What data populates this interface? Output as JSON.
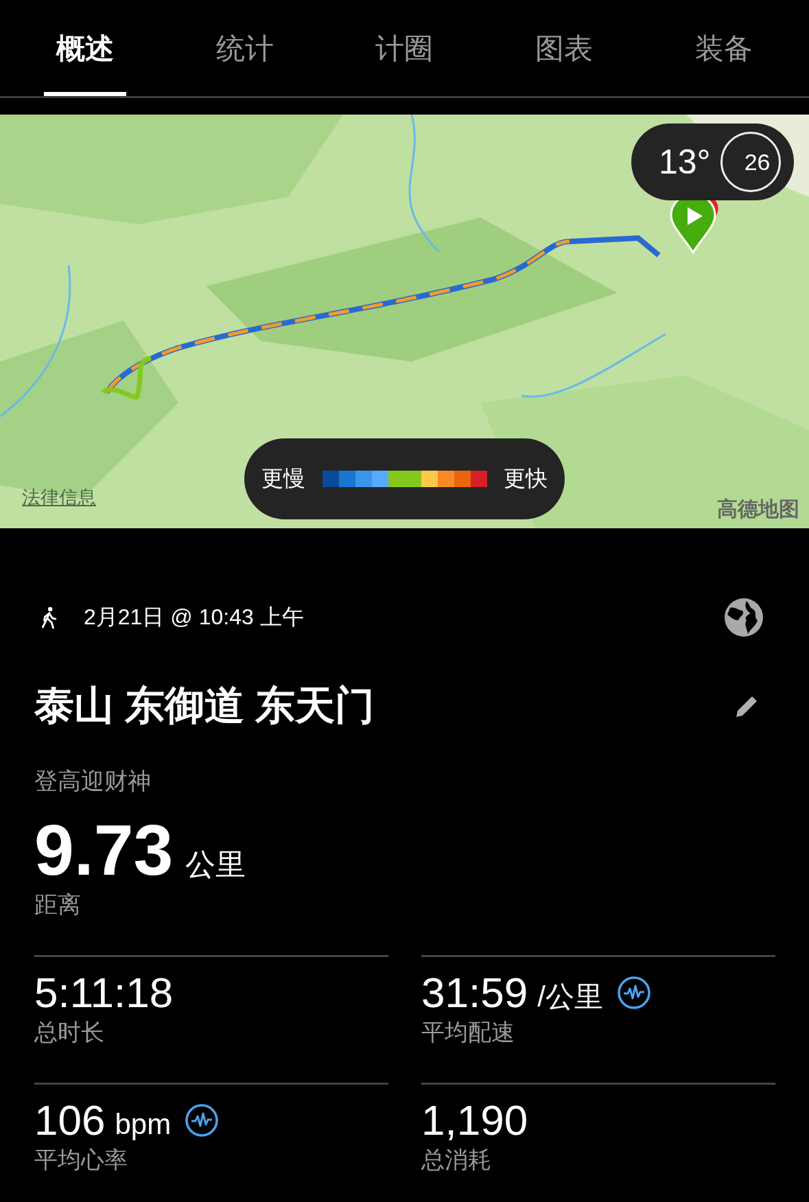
{
  "tabs": [
    {
      "label": "概述",
      "selected": true
    },
    {
      "label": "统计",
      "selected": false
    },
    {
      "label": "计圈",
      "selected": false
    },
    {
      "label": "图表",
      "selected": false
    },
    {
      "label": "装备",
      "selected": false
    }
  ],
  "map": {
    "kind": "picture",
    "weather": {
      "temperature": "13°",
      "wind": "26"
    },
    "legend": {
      "slow_label": "更慢",
      "fast_label": "更快",
      "colors": [
        {
          "color": "#0a4a9c"
        },
        {
          "color": "#1a75d2"
        },
        {
          "color": "#3a95ec"
        },
        {
          "color": "#56aaff"
        },
        {
          "color": "#84c81e"
        },
        {
          "color": "#84c81e"
        },
        {
          "color": "#fdc94b"
        },
        {
          "color": "#f88a26"
        },
        {
          "color": "#e8660f"
        },
        {
          "color": "#d42026"
        }
      ]
    },
    "legal_link": "法律信息",
    "provider": "高德地图"
  },
  "activity": {
    "datetime": "2月21日 @ 10:43 上午",
    "title": "泰山 东御道 东天门",
    "description": "登高迎财神",
    "distance": {
      "value": "9.73",
      "unit": "公里",
      "label": "距离"
    }
  },
  "stats": [
    {
      "value": "5:11:18",
      "label": "总时长",
      "chart_icon": false
    },
    {
      "value": "31:59",
      "unit": "/公里",
      "label": "平均配速",
      "chart_icon": true
    },
    {
      "value": "106",
      "unit": "bpm",
      "label": "平均心率",
      "chart_icon": true
    },
    {
      "value": "1,190",
      "label": "总消耗",
      "chart_icon": false
    }
  ]
}
